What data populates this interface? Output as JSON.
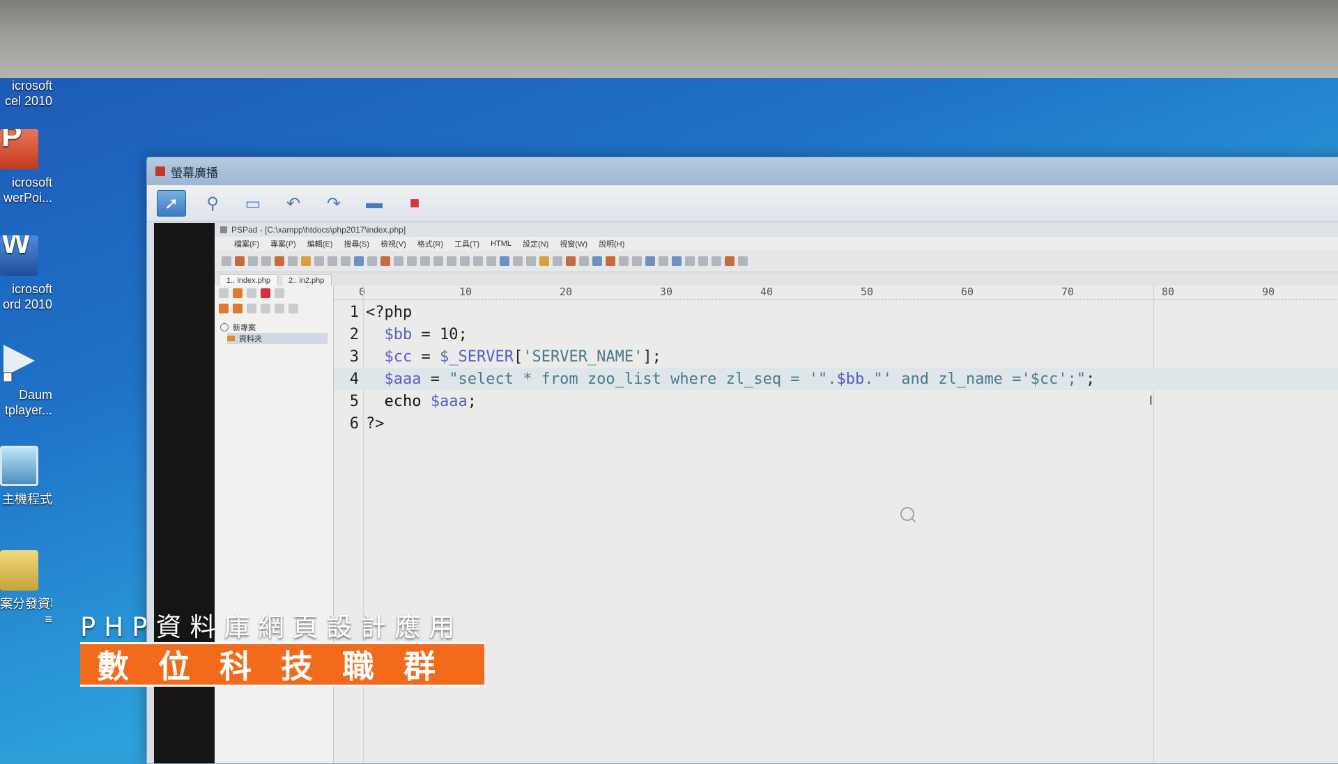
{
  "desktop_icons": [
    {
      "name": "excel",
      "label1": "icrosoft",
      "label2": "cel 2010"
    },
    {
      "name": "powerpoint",
      "label1": "icrosoft",
      "label2": "werPoi..."
    },
    {
      "name": "word",
      "label1": "icrosoft",
      "label2": "ord 2010"
    },
    {
      "name": "daum",
      "label1": "Daum",
      "label2": "tplayer..."
    },
    {
      "name": "pc",
      "label1": "主機程式",
      "label2": ""
    },
    {
      "name": "folder",
      "label1": "案分發資料",
      "label2": "≡"
    }
  ],
  "window": {
    "title": "螢幕廣播"
  },
  "pspad": {
    "title": "PSPad - [C:\\xampp\\htdocs\\php2017\\index.php]",
    "menu": [
      "檔案(F)",
      "專案(P)",
      "編輯(E)",
      "搜尋(S)",
      "檢視(V)",
      "格式(R)",
      "工具(T)",
      "HTML",
      "設定(N)",
      "視窗(W)",
      "說明(H)"
    ],
    "tabs": [
      "1.. index.php",
      "2.. in2.php"
    ],
    "tree": {
      "root": "新專案",
      "child": "資料夾"
    },
    "ruler": [
      "0",
      "10",
      "20",
      "30",
      "40",
      "50",
      "60",
      "70",
      "80",
      "90"
    ],
    "code": {
      "l1": "<?php",
      "l2a": "$bb",
      "l2b": " = 10;",
      "l3a": "$cc",
      "l3b": " = ",
      "l3c": "$_SERVER",
      "l3d": "[",
      "l3e": "'SERVER_NAME'",
      "l3f": "];",
      "l4a": "$aaa",
      "l4b": " = ",
      "l4c": "\"select * from zoo_list where zl_seq = '\".",
      "l4d": "$bb",
      "l4e": ".\"' and zl_name ='$cc';\"",
      "l4f": ";",
      "l5a": "echo ",
      "l5b": "$aaa",
      "l5c": ";",
      "l6": "?>"
    }
  },
  "caption": {
    "subtitle": "PHP資料庫網頁設計應用",
    "title": "數位科技職群"
  }
}
